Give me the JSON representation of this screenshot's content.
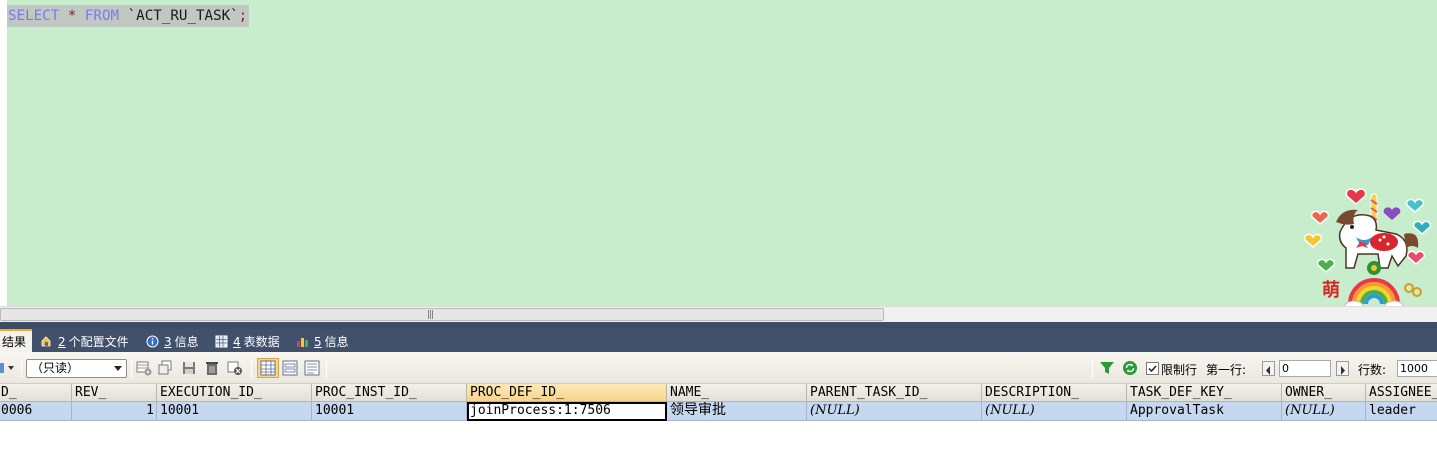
{
  "editor": {
    "sql": {
      "kw_select": "SELECT",
      "star": "*",
      "kw_from": "FROM",
      "table": "`ACT_RU_TASK`",
      "semicolon": ";"
    },
    "background": "#c8edcc",
    "sticker_char": "萌"
  },
  "result_tabs": [
    {
      "label": "结果",
      "active": true
    },
    {
      "num": "2",
      "label": "个配置文件"
    },
    {
      "num": "3",
      "label": "信息"
    },
    {
      "num": "4",
      "label": "表数据"
    },
    {
      "num": "5",
      "label": "信息"
    }
  ],
  "toolbar": {
    "mode_select": "（只读）",
    "filter_icon": "filter-icon",
    "limit_rows_label": "限制行",
    "limit_rows_checked": true,
    "first_row_label": "第一行:",
    "first_row_value": "0",
    "row_count_label": "行数:",
    "row_count_value": "1000"
  },
  "grid": {
    "columns": [
      "D_",
      "REV_",
      "EXECUTION_ID_",
      "PROC_INST_ID_",
      "PROC_DEF_ID_",
      "NAME_",
      "PARENT_TASK_ID_",
      "DESCRIPTION_",
      "TASK_DEF_KEY_",
      "OWNER_",
      "ASSIGNEE_"
    ],
    "rows": [
      [
        "0006",
        "1",
        "10001",
        "10001",
        "joinProcess:1:7506",
        "领导审批",
        "(NULL)",
        "(NULL)",
        "ApprovalTask",
        "(NULL)",
        "leader"
      ]
    ]
  },
  "colors": {
    "tab_bar": "#41516c",
    "active_tab_accent": "#f7a637",
    "selected_row": "#c6d7f0",
    "sql_keyword": "#7a7ae8"
  }
}
